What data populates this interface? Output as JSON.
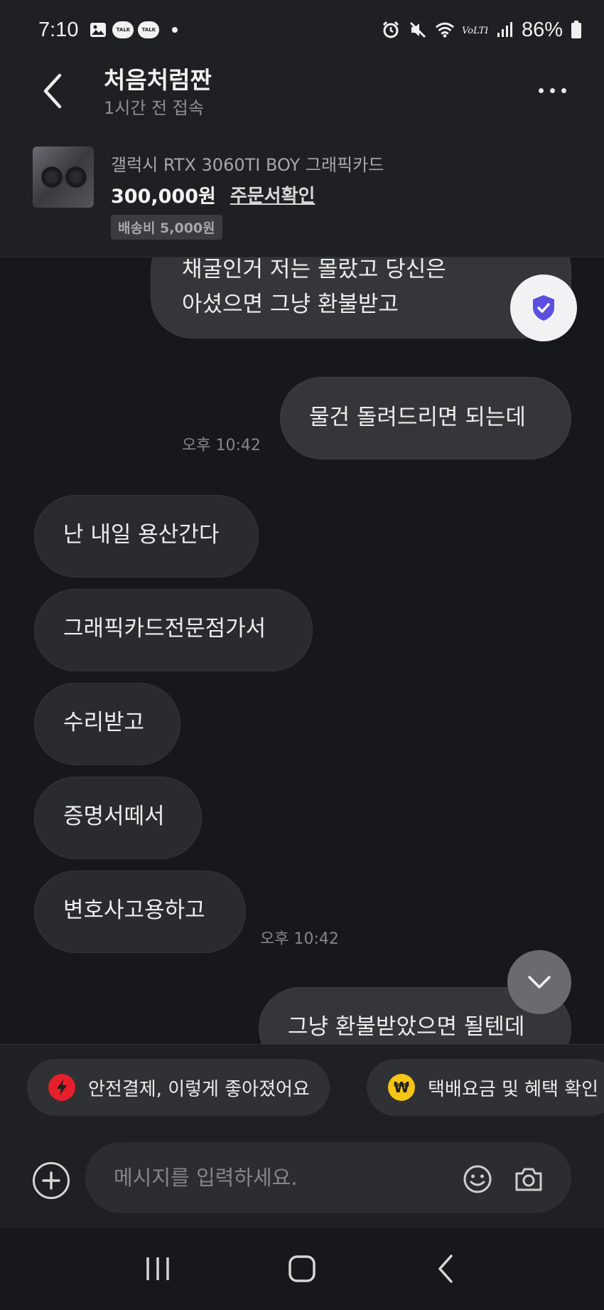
{
  "status_bar": {
    "time": "7:10",
    "talk_label": "TALK",
    "battery": "86%"
  },
  "header": {
    "name": "처음처럼짠",
    "last_seen": "1시간 전 접속"
  },
  "product": {
    "title": "갤럭시 RTX 3060TI BOY 그래픽카드",
    "price": "300,000원",
    "order_link": "주문서확인",
    "shipping": "배송비 5,000원"
  },
  "messages": [
    {
      "side": "right",
      "lines": [
        "채굴인거 저는 몰랐고 당신은",
        "아셨으면 그냥 환불받고"
      ]
    },
    {
      "side": "right",
      "lines": [
        "물건 돌려드리면 되는데"
      ],
      "time": "오후 10:42"
    },
    {
      "side": "left",
      "lines": [
        "난 내일 용산간다"
      ]
    },
    {
      "side": "left",
      "lines": [
        "그래픽카드전문점가서"
      ]
    },
    {
      "side": "left",
      "lines": [
        "수리받고"
      ]
    },
    {
      "side": "left",
      "lines": [
        "증명서떼서"
      ]
    },
    {
      "side": "left",
      "lines": [
        "변호사고용하고"
      ],
      "time": "오후 10:42"
    },
    {
      "side": "right",
      "lines": [
        "그냥 환불받았으면 될텐데"
      ]
    }
  ],
  "quick_chips": [
    {
      "label": "안전결제, 이렇게 좋아졌어요",
      "icon": "lightning-icon",
      "color": "#e5202a"
    },
    {
      "label": "택배요금 및 혜택 확인",
      "icon": "won-icon",
      "color": "#f5c518"
    }
  ],
  "input": {
    "placeholder": "메시지를 입력하세요."
  },
  "colors": {
    "background": "#17181b",
    "bubble_left": "#2a2b2f",
    "bubble_right": "#35363a",
    "shield_accent": "#5b4fe0"
  }
}
